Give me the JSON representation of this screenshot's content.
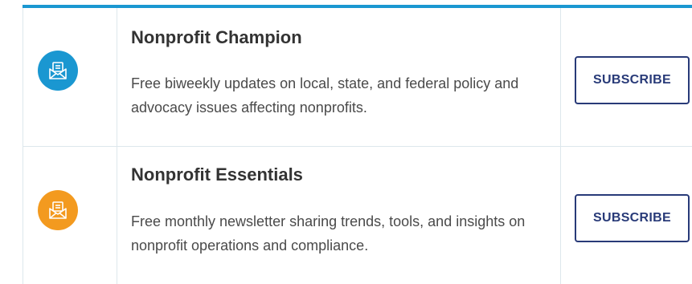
{
  "newsletters": [
    {
      "title": "Nonprofit Champion",
      "description": "Free biweekly updates on local, state, and federal policy and advocacy issues affecting nonprofits.",
      "button_label": "SUBSCRIBE",
      "icon": "envelope-icon",
      "icon_color": "#1a97d1"
    },
    {
      "title": "Nonprofit Essentials",
      "description": "Free monthly newsletter sharing trends, tools, and insights on nonprofit operations and compliance.",
      "button_label": "SUBSCRIBE",
      "icon": "envelope-icon",
      "icon_color": "#f39a1f"
    }
  ],
  "colors": {
    "accent_border": "#1a97d1",
    "button": "#283a78"
  }
}
